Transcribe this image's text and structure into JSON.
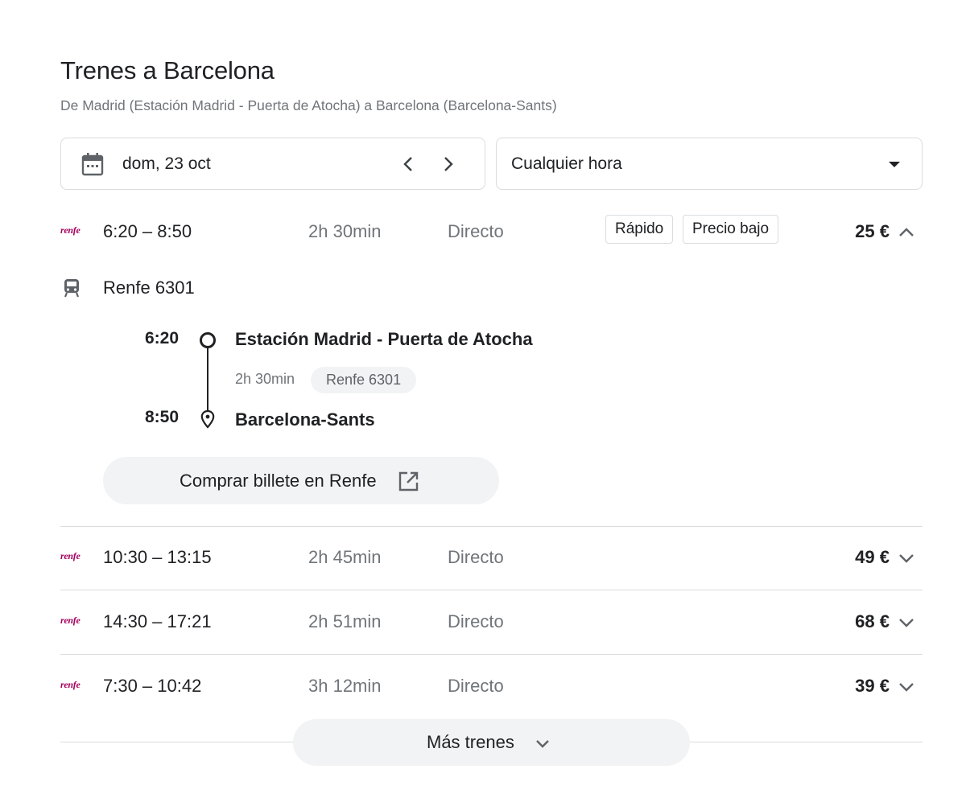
{
  "header": {
    "title": "Trenes a Barcelona",
    "subtitle": "De Madrid (Estación Madrid - Puerta de Atocha) a Barcelona (Barcelona-Sants)"
  },
  "filters": {
    "date": "dom, 23 oct",
    "time": "Cualquier hora",
    "icons": {
      "calendar": "calendar-icon",
      "prev": "chevron-left-icon",
      "next": "chevron-right-icon",
      "dropdown": "caret-down-icon"
    }
  },
  "results": [
    {
      "operator": "renfe",
      "times": "6:20 – 8:50",
      "duration": "2h 30min",
      "type": "Directo",
      "tags": [
        "Rápido",
        "Precio bajo"
      ],
      "price": "25 €",
      "expanded": true
    },
    {
      "operator": "renfe",
      "times": "10:30 – 13:15",
      "duration": "2h 45min",
      "type": "Directo",
      "tags": [],
      "price": "49 €",
      "expanded": false
    },
    {
      "operator": "renfe",
      "times": "14:30 – 17:21",
      "duration": "2h 51min",
      "type": "Directo",
      "tags": [],
      "price": "68 €",
      "expanded": false
    },
    {
      "operator": "renfe",
      "times": "7:30 – 10:42",
      "duration": "3h 12min",
      "type": "Directo",
      "tags": [],
      "price": "39 €",
      "expanded": false
    }
  ],
  "details": {
    "train_name": "Renfe 6301",
    "origin_time": "6:20",
    "origin_station": "Estación Madrid - Puerta de Atocha",
    "segment_duration": "2h 30min",
    "segment_train": "Renfe 6301",
    "dest_time": "8:50",
    "dest_station": "Barcelona-Sants",
    "buy_label": "Comprar billete en Renfe"
  },
  "more_button": "Más trenes",
  "colors": {
    "brand": "#a4005d",
    "text": "#202124",
    "secondary": "#70757a",
    "border": "#dadce0",
    "chip_bg": "#f1f3f4"
  }
}
